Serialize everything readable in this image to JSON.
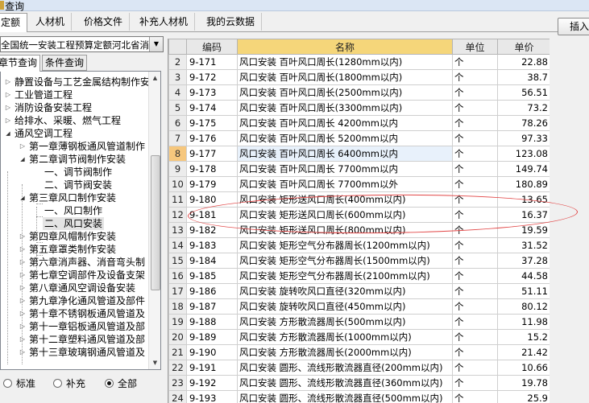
{
  "window": {
    "title": "查询"
  },
  "tabs": [
    {
      "label": "定额",
      "active": true
    },
    {
      "label": "人材机",
      "active": false
    },
    {
      "label": "价格文件",
      "active": false
    },
    {
      "label": "补充人材机",
      "active": false
    },
    {
      "label": "我的云数据",
      "active": false
    }
  ],
  "toolbar": {
    "insert_label": "插入"
  },
  "library_select": {
    "value": "全国统一安装工程预算定额河北省消"
  },
  "subtabs": [
    {
      "label": "章节查询",
      "active": true
    },
    {
      "label": "条件查询",
      "active": false
    }
  ],
  "tree": [
    {
      "label": "静置设备与工艺金属结构制作安",
      "level": 0,
      "state": "collapsed"
    },
    {
      "label": "工业管道工程",
      "level": 0,
      "state": "collapsed"
    },
    {
      "label": "消防设备安装工程",
      "level": 0,
      "state": "collapsed"
    },
    {
      "label": "给排水、采暖、燃气工程",
      "level": 0,
      "state": "collapsed"
    },
    {
      "label": "通风空调工程",
      "level": 0,
      "state": "expanded"
    },
    {
      "label": "第一章薄钢板通风管道制作",
      "level": 1,
      "state": "collapsed"
    },
    {
      "label": "第二章调节阀制作安装",
      "level": 1,
      "state": "expanded"
    },
    {
      "label": "一、调节阀制作",
      "level": 2,
      "state": "leaf"
    },
    {
      "label": "二、调节阀安装",
      "level": 2,
      "state": "leaf"
    },
    {
      "label": "第三章风口制作安装",
      "level": 1,
      "state": "expanded"
    },
    {
      "label": "一、风口制作",
      "level": 2,
      "state": "leaf"
    },
    {
      "label": "二、风口安装",
      "level": 2,
      "state": "leaf",
      "selected": true
    },
    {
      "label": "第四章风帽制作安装",
      "level": 1,
      "state": "collapsed"
    },
    {
      "label": "第五章罩类制作安装",
      "level": 1,
      "state": "collapsed"
    },
    {
      "label": "第六章消声器、消音弯头制",
      "level": 1,
      "state": "collapsed"
    },
    {
      "label": "第七章空调部件及设备支架",
      "level": 1,
      "state": "collapsed"
    },
    {
      "label": "第八章通风空调设备安装",
      "level": 1,
      "state": "collapsed"
    },
    {
      "label": "第九章净化通风管道及部件",
      "level": 1,
      "state": "collapsed"
    },
    {
      "label": "第十章不锈钢板通风管道及",
      "level": 1,
      "state": "collapsed"
    },
    {
      "label": "第十一章铝板通风管道及部",
      "level": 1,
      "state": "collapsed"
    },
    {
      "label": "第十二章塑料通风管道及部",
      "level": 1,
      "state": "collapsed"
    },
    {
      "label": "第十三章玻璃钢通风管道及",
      "level": 1,
      "state": "collapsed"
    }
  ],
  "filter": {
    "options": [
      {
        "label": "标准",
        "checked": false
      },
      {
        "label": "补充",
        "checked": false
      },
      {
        "label": "全部",
        "checked": true
      }
    ]
  },
  "table": {
    "columns": [
      "",
      "编码",
      "名称",
      "单位",
      "单价"
    ],
    "rows": [
      {
        "n": "2",
        "code": "9-171",
        "name": "风口安装 百叶风口周长(1280mm以内)",
        "unit": "个",
        "price": "22.88"
      },
      {
        "n": "3",
        "code": "9-172",
        "name": "风口安装 百叶风口周长(1800mm以内)",
        "unit": "个",
        "price": "38.7"
      },
      {
        "n": "4",
        "code": "9-173",
        "name": "风口安装 百叶风口周长(2500mm以内)",
        "unit": "个",
        "price": "56.51"
      },
      {
        "n": "5",
        "code": "9-174",
        "name": "风口安装 百叶风口周长(3300mm以内)",
        "unit": "个",
        "price": "73.2"
      },
      {
        "n": "6",
        "code": "9-175",
        "name": "风口安装 百叶风口周长 4200mm以内",
        "unit": "个",
        "price": "78.26"
      },
      {
        "n": "7",
        "code": "9-176",
        "name": "风口安装 百叶风口周长 5200mm以内",
        "unit": "个",
        "price": "97.33"
      },
      {
        "n": "8",
        "code": "9-177",
        "name": "风口安装 百叶风口周长 6400mm以内",
        "unit": "个",
        "price": "123.08",
        "current": true
      },
      {
        "n": "9",
        "code": "9-178",
        "name": "风口安装 百叶风口周长 7700mm以内",
        "unit": "个",
        "price": "149.74"
      },
      {
        "n": "10",
        "code": "9-179",
        "name": "风口安装 百叶风口周长 7700mm以外",
        "unit": "个",
        "price": "180.89"
      },
      {
        "n": "11",
        "code": "9-180",
        "name": "风口安装 矩形送风口周长(400mm以内)",
        "unit": "个",
        "price": "13.65"
      },
      {
        "n": "12",
        "code": "9-181",
        "name": "风口安装 矩形送风口周长(600mm以内)",
        "unit": "个",
        "price": "16.37"
      },
      {
        "n": "13",
        "code": "9-182",
        "name": "风口安装 矩形送风口周长(800mm以内)",
        "unit": "个",
        "price": "19.59"
      },
      {
        "n": "14",
        "code": "9-183",
        "name": "风口安装 矩形空气分布器周长(1200mm以内)",
        "unit": "个",
        "price": "31.52"
      },
      {
        "n": "15",
        "code": "9-184",
        "name": "风口安装 矩形空气分布器周长(1500mm以内)",
        "unit": "个",
        "price": "37.28"
      },
      {
        "n": "16",
        "code": "9-185",
        "name": "风口安装 矩形空气分布器周长(2100mm以内)",
        "unit": "个",
        "price": "44.58"
      },
      {
        "n": "17",
        "code": "9-186",
        "name": "风口安装 旋转吹风口直径(320mm以内)",
        "unit": "个",
        "price": "51.11"
      },
      {
        "n": "18",
        "code": "9-187",
        "name": "风口安装 旋转吹风口直径(450mm以内)",
        "unit": "个",
        "price": "80.12"
      },
      {
        "n": "19",
        "code": "9-188",
        "name": "风口安装 方形散流器周长(500mm以内)",
        "unit": "个",
        "price": "11.98"
      },
      {
        "n": "20",
        "code": "9-189",
        "name": "风口安装 方形散流器周长(1000mm以内)",
        "unit": "个",
        "price": "15.2"
      },
      {
        "n": "21",
        "code": "9-190",
        "name": "风口安装 方形散流器周长(2000mm以内)",
        "unit": "个",
        "price": "21.42"
      },
      {
        "n": "22",
        "code": "9-191",
        "name": "风口安装 圆形、流线形散流器直径(200mm以内)",
        "unit": "个",
        "price": "10.66"
      },
      {
        "n": "23",
        "code": "9-192",
        "name": "风口安装 圆形、流线形散流器直径(360mm以内)",
        "unit": "个",
        "price": "19.78"
      },
      {
        "n": "24",
        "code": "9-193",
        "name": "风口安装 圆形、流线形散流器直径(500mm以内)",
        "unit": "个",
        "price": "25.9"
      }
    ]
  },
  "colors": {
    "header_name_bg": "#f5d67a",
    "current_row_marker": "#f6c77d",
    "annotation_ellipse": "#e24747"
  }
}
